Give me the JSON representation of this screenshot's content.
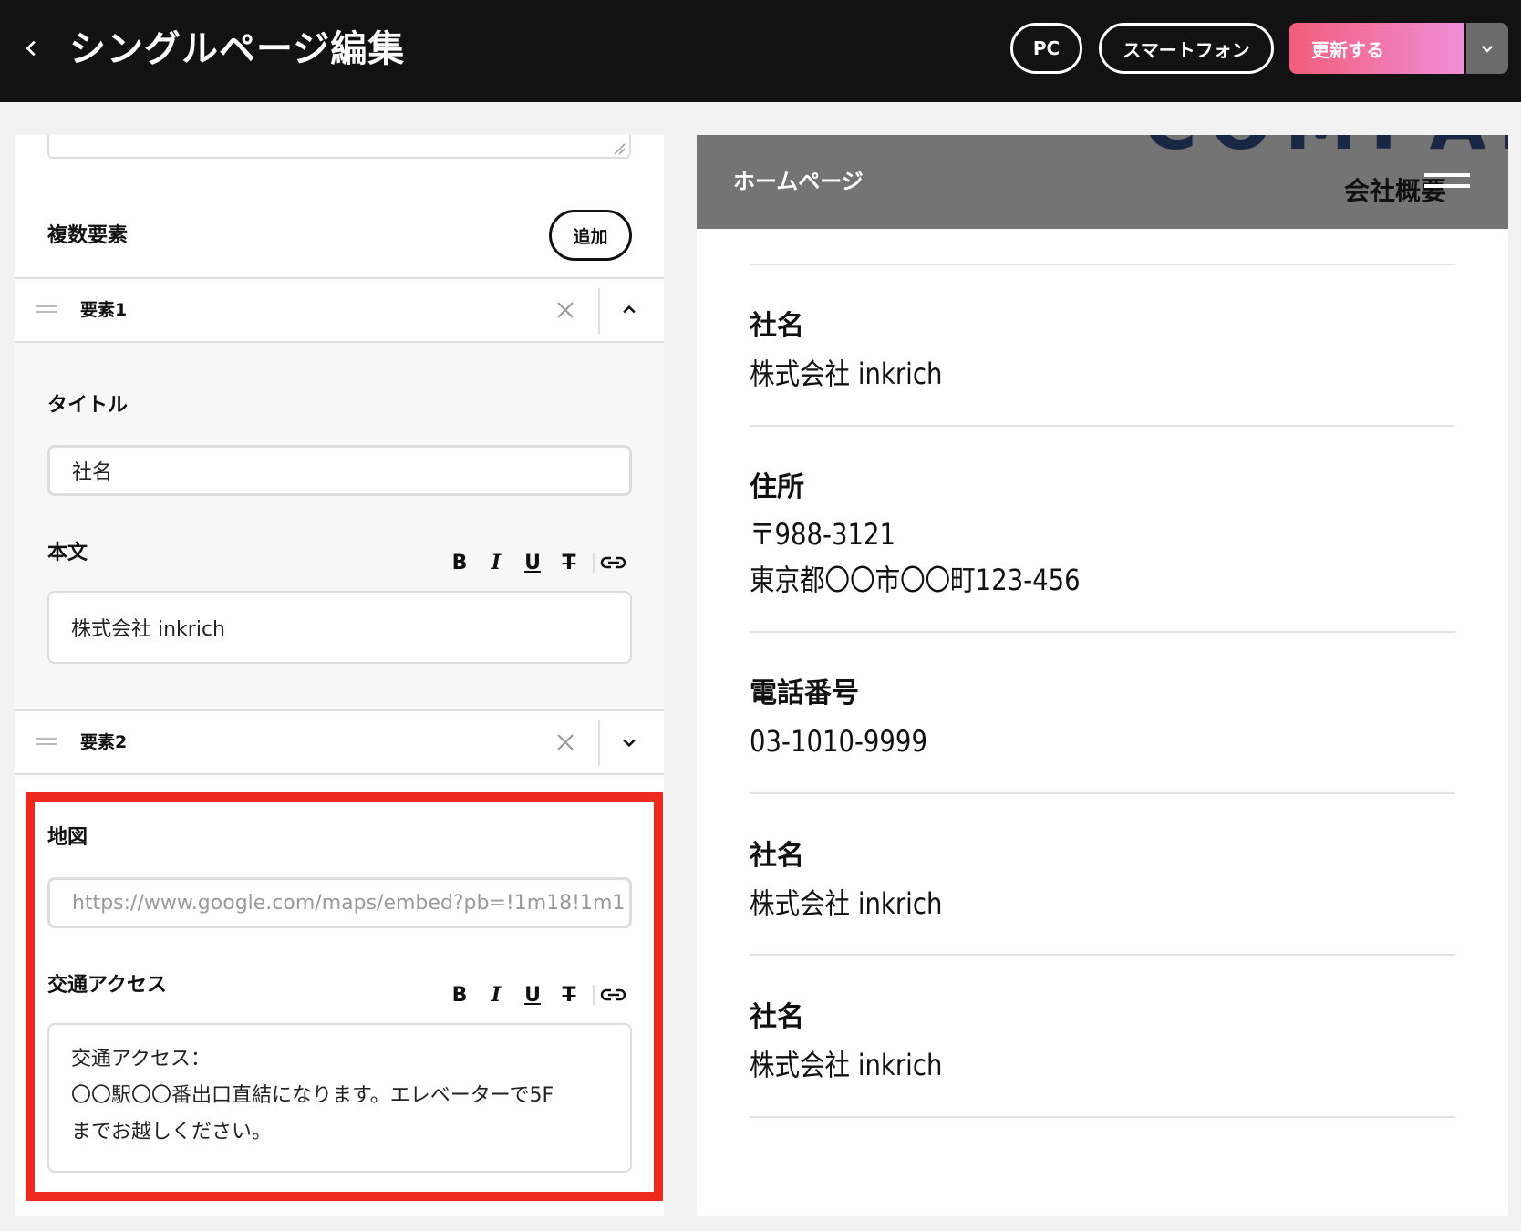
{
  "header": {
    "title": "シングルページ編集",
    "device_pc": "PC",
    "device_smartphone": "スマートフォン",
    "update_label": "更新する"
  },
  "editor": {
    "multi_section_label": "複数要素",
    "add_label": "追加",
    "elements": [
      {
        "label": "要素1",
        "title_label": "タイトル",
        "title_value": "社名",
        "body_label": "本文",
        "body_value": "株式会社 inkrich"
      },
      {
        "label": "要素2",
        "map_label": "地図",
        "map_placeholder": "https://www.google.com/maps/embed?pb=!1m18!1m1",
        "access_label": "交通アクセス",
        "access_lines": [
          "交通アクセス：",
          "〇〇駅〇〇番出口直結になります。エレベーターで5F",
          "までお越しください。"
        ]
      }
    ],
    "toolbar": {
      "bold": "B",
      "italic": "I",
      "underline": "U",
      "strike": "T"
    }
  },
  "preview": {
    "brand": "ホームページ",
    "company_heading": "COMPANY",
    "nav_item": "会社概要",
    "rows": [
      {
        "title": "社名",
        "lines": [
          "株式会社 inkrich"
        ]
      },
      {
        "title": "住所",
        "lines": [
          "〒988-3121",
          "東京都〇〇市〇〇町123-456"
        ]
      },
      {
        "title": "電話番号",
        "lines": [
          "03-1010-9999"
        ]
      },
      {
        "title": "社名",
        "lines": [
          "株式会社 inkrich"
        ]
      },
      {
        "title": "社名",
        "lines": [
          "株式会社 inkrich"
        ]
      }
    ]
  }
}
